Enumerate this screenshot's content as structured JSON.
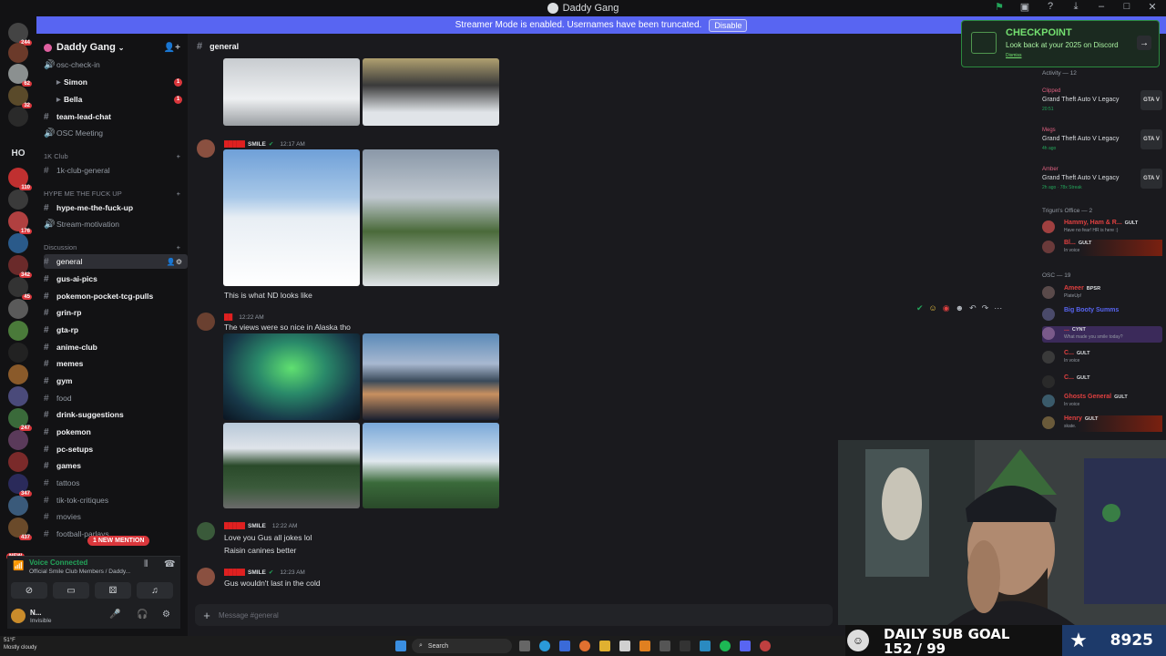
{
  "window": {
    "title": "Daddy Gang"
  },
  "banner": {
    "text": "Streamer Mode is enabled. Usernames have been truncated.",
    "button": "Disable"
  },
  "guild_badges": [
    "244",
    "62",
    "32",
    "110",
    "176",
    "342",
    "45",
    "247",
    "347",
    "437"
  ],
  "guild_text": "HO",
  "new_label": "NEW",
  "server": {
    "name": "Daddy Gang"
  },
  "channels": {
    "osc_check_in": "osc-check-in",
    "simon": "Simon",
    "bella": "Bella",
    "team_lead_chat": "team-lead-chat",
    "osc_meeting": "OSC Meeting",
    "cat_1k": "1K Club",
    "club_general": "1k-club-general",
    "cat_hype": "HYPE ME THE FUCK UP",
    "hype": "hype-me-the-fuck-up",
    "stream_motivation": "Stream-motivation",
    "cat_discussion": "Discussion",
    "general": "general",
    "gus_ai": "gus-ai-pics",
    "pokemon_pocket": "pokemon-pocket-tcg-pulls",
    "grin_rp": "grin-rp",
    "gta_rp": "gta-rp",
    "anime_club": "anime-club",
    "memes": "memes",
    "gym": "gym",
    "food": "food",
    "drink": "drink-suggestions",
    "pokemon": "pokemon",
    "pc_setups": "pc-setups",
    "games": "games",
    "tattoos": "tattoos",
    "tiktok": "tik-tok-critiques",
    "movies": "movies",
    "football": "football-parlays",
    "unread_count": "1"
  },
  "mention_pill": "1 NEW MENTION",
  "voice": {
    "status": "Voice Connected",
    "channel": "Official Smile Club Members / Daddy..."
  },
  "user": {
    "name": "N...",
    "status": "Invisible"
  },
  "header": {
    "channel": "general"
  },
  "messages": [
    {
      "tag": "SMILE",
      "time": "12:17 AM",
      "text": "This is what ND looks like"
    },
    {
      "time": "12:22 AM",
      "text": "The views were so nice in Alaska tho"
    },
    {
      "tag": "SMILE",
      "time": "12:22 AM",
      "text1": "Love you Gus all jokes lol",
      "text2": "Raisin canines better"
    },
    {
      "tag": "SMILE",
      "time": "12:23 AM",
      "text": "Gus wouldn't last in the cold"
    }
  ],
  "composer": {
    "placeholder": "Message #general"
  },
  "checkpoint": {
    "title": "CHECKPOINT",
    "subtitle": "Look back at your 2025 on Discord",
    "dismiss": "Dismiss"
  },
  "activity": {
    "header": "Activity — 12",
    "items": [
      {
        "user": "Clipped",
        "game": "Grand Theft Auto V Legacy",
        "time": "20:51"
      },
      {
        "user": "Megs",
        "game": "Grand Theft Auto V Legacy",
        "time": "4h ago"
      },
      {
        "user": "Amber",
        "game": "Grand Theft Auto V Legacy",
        "time": "2h ago · 78x Streak"
      }
    ],
    "game_icon": "GTA V"
  },
  "trigun": {
    "header": "Trigun's Office — 2",
    "members": [
      {
        "name": "Hammy, Ham & R...",
        "tag": "GULT",
        "status": "Have no fear! HR is here :)",
        "color": "#e04040"
      },
      {
        "name": "Bl...",
        "tag": "GULT",
        "status": "In voice",
        "color": "#e04040"
      }
    ]
  },
  "osc": {
    "header": "OSC — 19",
    "members": [
      {
        "name": "Ameer",
        "tag": "BPSR",
        "status": "PlateUp!",
        "color": "#e04040"
      },
      {
        "name": "Big Booty Summs",
        "tag": "",
        "status": "",
        "color": "#5865f2"
      },
      {
        "name": "...",
        "tag": "CYNT",
        "status": "What made you smile today?",
        "color": "#e04040"
      },
      {
        "name": "C...",
        "tag": "GULT",
        "status": "In voice",
        "color": "#e04040"
      },
      {
        "name": "C...",
        "tag": "GULT",
        "status": "",
        "color": "#e04040"
      },
      {
        "name": "Ghosts General",
        "tag": "GULT",
        "status": "In voice",
        "color": "#e04040"
      },
      {
        "name": "Henry",
        "tag": "GULT",
        "status": "skate.",
        "color": "#e04040"
      }
    ]
  },
  "subgoal": {
    "title": "DAILY SUB GOAL",
    "value": "152 / 99",
    "count": "8925"
  },
  "taskbar": {
    "weather_temp": "51°F",
    "weather_desc": "Mostly cloudy",
    "search": "Search"
  },
  "colors": {
    "accent": "#5865f2",
    "mention": "#da373c",
    "online": "#23a55a",
    "checkpoint": "#74e070"
  }
}
